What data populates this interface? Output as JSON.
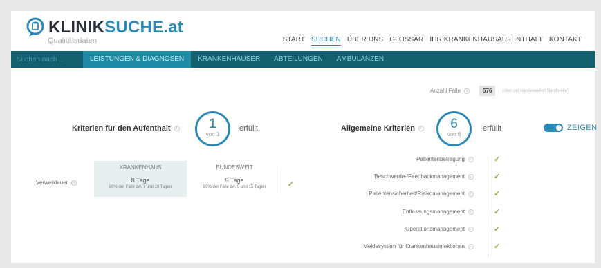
{
  "header": {
    "logo_part1": "KLINIK",
    "logo_part2": "SUCHE.at",
    "subtitle": "Qualitätsdaten"
  },
  "top_nav": [
    {
      "label": "START",
      "active": false
    },
    {
      "label": "SUCHEN",
      "active": true
    },
    {
      "label": "ÜBER UNS",
      "active": false
    },
    {
      "label": "GLOSSAR",
      "active": false
    },
    {
      "label": "IHR KRANKENHAUSAUFENTHALT",
      "active": false
    },
    {
      "label": "KONTAKT",
      "active": false
    }
  ],
  "navbar": {
    "search_placeholder": "Suchen nach ...",
    "items": [
      {
        "label": "LEISTUNGEN & DIAGNOSEN",
        "active": true
      },
      {
        "label": "KRANKENHÄUSER",
        "active": false
      },
      {
        "label": "ABTEILUNGEN",
        "active": false
      },
      {
        "label": "AMBULANZEN",
        "active": false
      }
    ]
  },
  "cases": {
    "label": "Anzahl Fälle",
    "count": "576",
    "note": "(über der bundesweiten Bandbreite)"
  },
  "stay_criteria": {
    "title": "Kriterien für den Aufenthalt",
    "fulfilled": "1",
    "total_label": "von 1",
    "status": "erfüllt",
    "columns": [
      "KRANKENHAUS",
      "BUNDESWEIT"
    ],
    "row": {
      "label": "Verweildauer",
      "hospital_value": "8 Tage",
      "hospital_sub": "80% der Fälle zw. 7 und 10 Tagen",
      "national_value": "9 Tage",
      "national_sub": "80% der Fälle zw. 5 und 15 Tagen"
    }
  },
  "general_criteria": {
    "title": "Allgemeine Kriterien",
    "fulfilled": "6",
    "total_label": "von 6",
    "status": "erfüllt",
    "toggle_label": "ZEIGEN",
    "toggle_on": true,
    "items": [
      {
        "label": "Patientenbefragung"
      },
      {
        "label": "Beschwerde-/Feedbackmanagement"
      },
      {
        "label": "Patientensicherheit/Risikomanagement"
      },
      {
        "label": "Entlassungsmanagement"
      },
      {
        "label": "Operationsmanagement"
      },
      {
        "label": "Meldesystem für Krankenhausinfektionen"
      }
    ]
  },
  "colors": {
    "brand_dark": "#2b2f3a",
    "brand_blue": "#2a8ab5",
    "nav_bg": "#125f70",
    "check_green": "#8bb83a"
  }
}
